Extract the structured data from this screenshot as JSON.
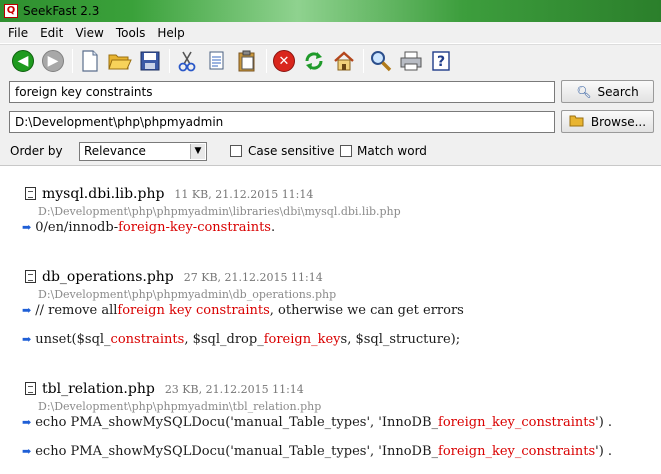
{
  "window": {
    "title": "SeekFast 2.3",
    "app_icon": "magnifier-q-icon"
  },
  "menu": [
    "File",
    "Edit",
    "View",
    "Tools",
    "Help"
  ],
  "toolbar": {
    "icons": [
      "back-icon",
      "forward-icon",
      "new-document-icon",
      "open-folder-icon",
      "save-icon",
      "cut-icon",
      "copy-icon",
      "paste-icon",
      "stop-icon",
      "refresh-icon",
      "home-icon",
      "find-icon",
      "print-icon",
      "help-icon"
    ]
  },
  "search": {
    "query": "foreign key constraints",
    "button_label": "Search"
  },
  "folder": {
    "path": "D:\\Development\\php\\phpmyadmin",
    "button_label": "Browse..."
  },
  "options": {
    "order_label": "Order by",
    "order_value": "Relevance",
    "case_sensitive_label": "Case sensitive",
    "match_word_label": "Match word",
    "case_sensitive_checked": false,
    "match_word_checked": false
  },
  "results": [
    {
      "name": "mysql.dbi.lib.php",
      "meta": "11 KB, 21.12.2015 11:14",
      "path": "D:\\Development\\php\\phpmyadmin\\libraries\\dbi\\mysql.dbi.lib.php",
      "matches": [
        [
          {
            "t": "0/en/innodb-",
            "h": false
          },
          {
            "t": "foreign-key-constraints",
            "h": true
          },
          {
            "t": ".",
            "h": false
          }
        ]
      ]
    },
    {
      "name": "db_operations.php",
      "meta": "27 KB, 21.12.2015 11:14",
      "path": "D:\\Development\\php\\phpmyadmin\\db_operations.php",
      "matches": [
        [
          {
            "t": "// remove all ",
            "h": false
          },
          {
            "t": "foreign key constraints",
            "h": true
          },
          {
            "t": ", otherwise we can get errors",
            "h": false
          }
        ],
        [
          {
            "t": "unset($sql_",
            "h": false
          },
          {
            "t": "constraints",
            "h": true
          },
          {
            "t": ", $sql_drop_",
            "h": false
          },
          {
            "t": "foreign_key",
            "h": true
          },
          {
            "t": "s, $sql_structure);",
            "h": false
          }
        ]
      ]
    },
    {
      "name": "tbl_relation.php",
      "meta": "23 KB, 21.12.2015 11:14",
      "path": "D:\\Development\\php\\phpmyadmin\\tbl_relation.php",
      "matches": [
        [
          {
            "t": "echo PMA_showMySQLDocu('manual_Table_types', 'InnoDB_",
            "h": false
          },
          {
            "t": "foreign_key_constraints",
            "h": true
          },
          {
            "t": "') .",
            "h": false
          }
        ],
        [
          {
            "t": "echo PMA_showMySQLDocu('manual_Table_types', 'InnoDB_",
            "h": false
          },
          {
            "t": "foreign_key_constraints",
            "h": true
          },
          {
            "t": "') .",
            "h": false
          }
        ]
      ]
    }
  ]
}
